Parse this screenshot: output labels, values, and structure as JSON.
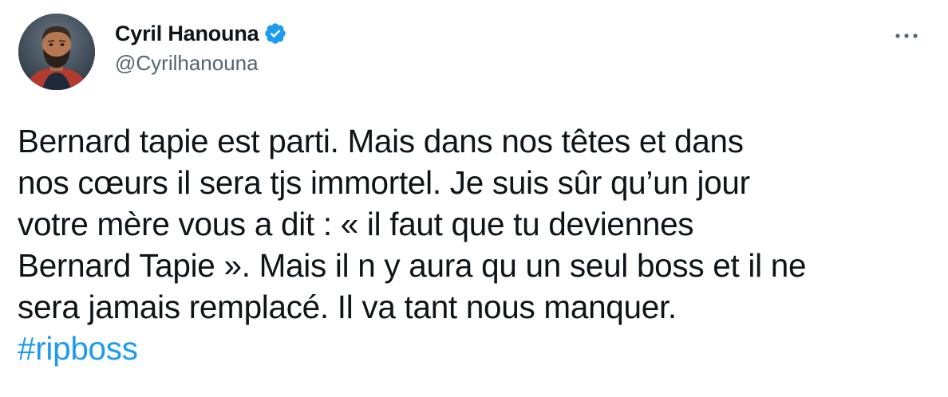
{
  "author": {
    "display_name": "Cyril Hanouna",
    "handle": "@Cyrilhanouna",
    "verified": true,
    "avatar_icon": "profile-photo"
  },
  "menu_icon": "more-horizontal-icon",
  "tweet": {
    "lines": [
      "Bernard tapie est parti. Mais dans nos têtes et dans",
      "nos cœurs il sera tjs immortel. Je suis sûr qu’un jour",
      "votre mère vous a dit : « il faut que tu deviennes",
      "Bernard Tapie ». Mais il n y aura qu un seul boss et il ne",
      "sera jamais remplacé. Il va tant nous manquer."
    ],
    "hashtag": "#ripboss"
  },
  "colors": {
    "text": "#0f1419",
    "secondary": "#536471",
    "accent": "#1d9bf0"
  }
}
